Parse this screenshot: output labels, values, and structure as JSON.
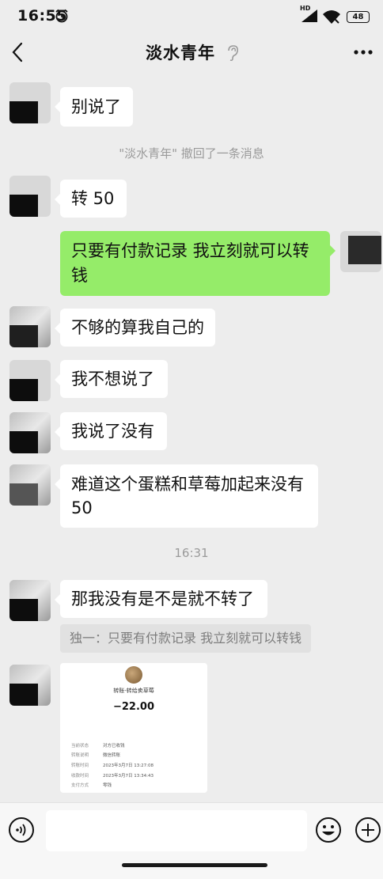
{
  "status_bar": {
    "time": "16:55",
    "hd": "HD",
    "battery": "48"
  },
  "header": {
    "title": "淡水青年"
  },
  "messages": [
    {
      "side": "left",
      "text": "别说了"
    },
    {
      "side": "left",
      "text": "转 50"
    },
    {
      "side": "right",
      "text_line1": "只要有付款记录 我立刻就可以转",
      "text_line2": "钱"
    },
    {
      "side": "left",
      "text": "不够的算我自己的"
    },
    {
      "side": "left",
      "text": "我不想说了"
    },
    {
      "side": "left",
      "text": "我说了没有"
    },
    {
      "side": "left",
      "text_line1": "难道这个蛋糕和草莓加起来没有",
      "text_line2": "50"
    },
    {
      "side": "left",
      "text": "那我没有是不是就不转了"
    }
  ],
  "recall_notice": "\"淡水青年\" 撤回了一条消息",
  "timestamp": "16:31",
  "quote": "独一：只要有付款记录 我立刻就可以转钱",
  "receipt": {
    "title": "转账-转给卖草莓",
    "amount": "−22.00",
    "rows": [
      {
        "k": "当前状态",
        "v": "对方已收钱"
      },
      {
        "k": "转账说明",
        "v": "微信转账"
      },
      {
        "k": "转账时间",
        "v": "2023年3月7日 13:27:08"
      },
      {
        "k": "收款时间",
        "v": "2023年3月7日 13:34:43"
      },
      {
        "k": "支付方式",
        "v": "零钱"
      }
    ]
  },
  "icons": [
    "alarm-icon",
    "signal-icon",
    "wifi-icon",
    "back-icon",
    "ear-icon",
    "more-icon",
    "voice-icon",
    "emoji-icon",
    "plus-icon"
  ],
  "colors": {
    "background": "#ededed",
    "self_bubble": "#95ec69",
    "other_bubble": "#ffffff"
  }
}
